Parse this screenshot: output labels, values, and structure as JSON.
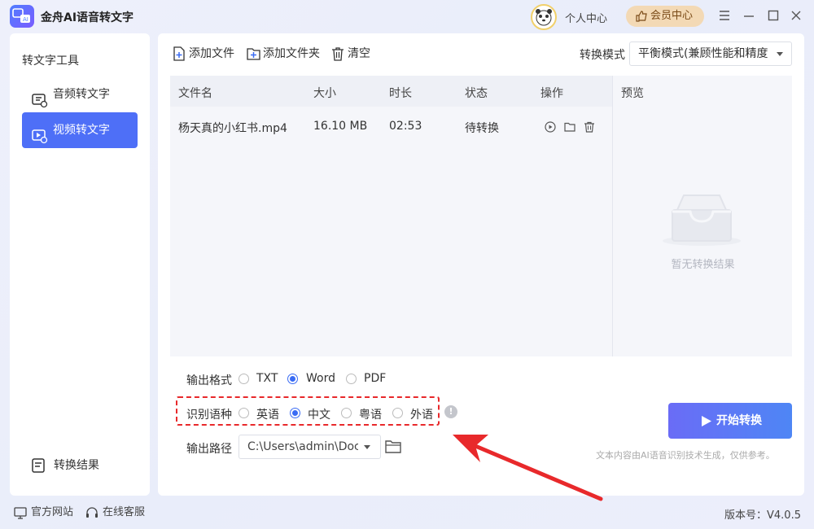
{
  "app": {
    "title": "金舟AI语音转文字"
  },
  "header": {
    "user_center": "个人中心",
    "vip_center": "会员中心"
  },
  "sidebar": {
    "title": "转文字工具",
    "items": [
      {
        "label": "音频转文字"
      },
      {
        "label": "视频转文字"
      }
    ],
    "bottom": "转换结果"
  },
  "toolbar": {
    "add_file": "添加文件",
    "add_folder": "添加文件夹",
    "clear": "清空",
    "mode_label": "转换模式",
    "mode_value": "平衡模式(兼顾性能和精度"
  },
  "table": {
    "headers": [
      "文件名",
      "大小",
      "时长",
      "状态",
      "操作"
    ],
    "rows": [
      {
        "name": "杨天真的小红书.mp4",
        "size": "16.10 MB",
        "duration": "02:53",
        "status": "待转换"
      }
    ]
  },
  "preview": {
    "title": "预览",
    "empty_text": "暂无转换结果"
  },
  "options": {
    "format_label": "输出格式",
    "formats": [
      "TXT",
      "Word",
      "PDF"
    ],
    "format_selected": "Word",
    "language_label": "识别语种",
    "languages": [
      "英语",
      "中文",
      "粤语",
      "外语"
    ],
    "language_selected": "中文",
    "path_label": "输出路径",
    "path_value": "C:\\Users\\admin\\Doc"
  },
  "actions": {
    "start": "开始转换",
    "disclaimer": "文本内容由AI语音识别技术生成，仅供参考。"
  },
  "statusbar": {
    "website": "官方网站",
    "support": "在线客服",
    "version": "版本号：V4.0.5"
  },
  "colors": {
    "accent": "#4e6ff7",
    "highlight": "#e8292b",
    "vip": "#f3d9b5"
  }
}
